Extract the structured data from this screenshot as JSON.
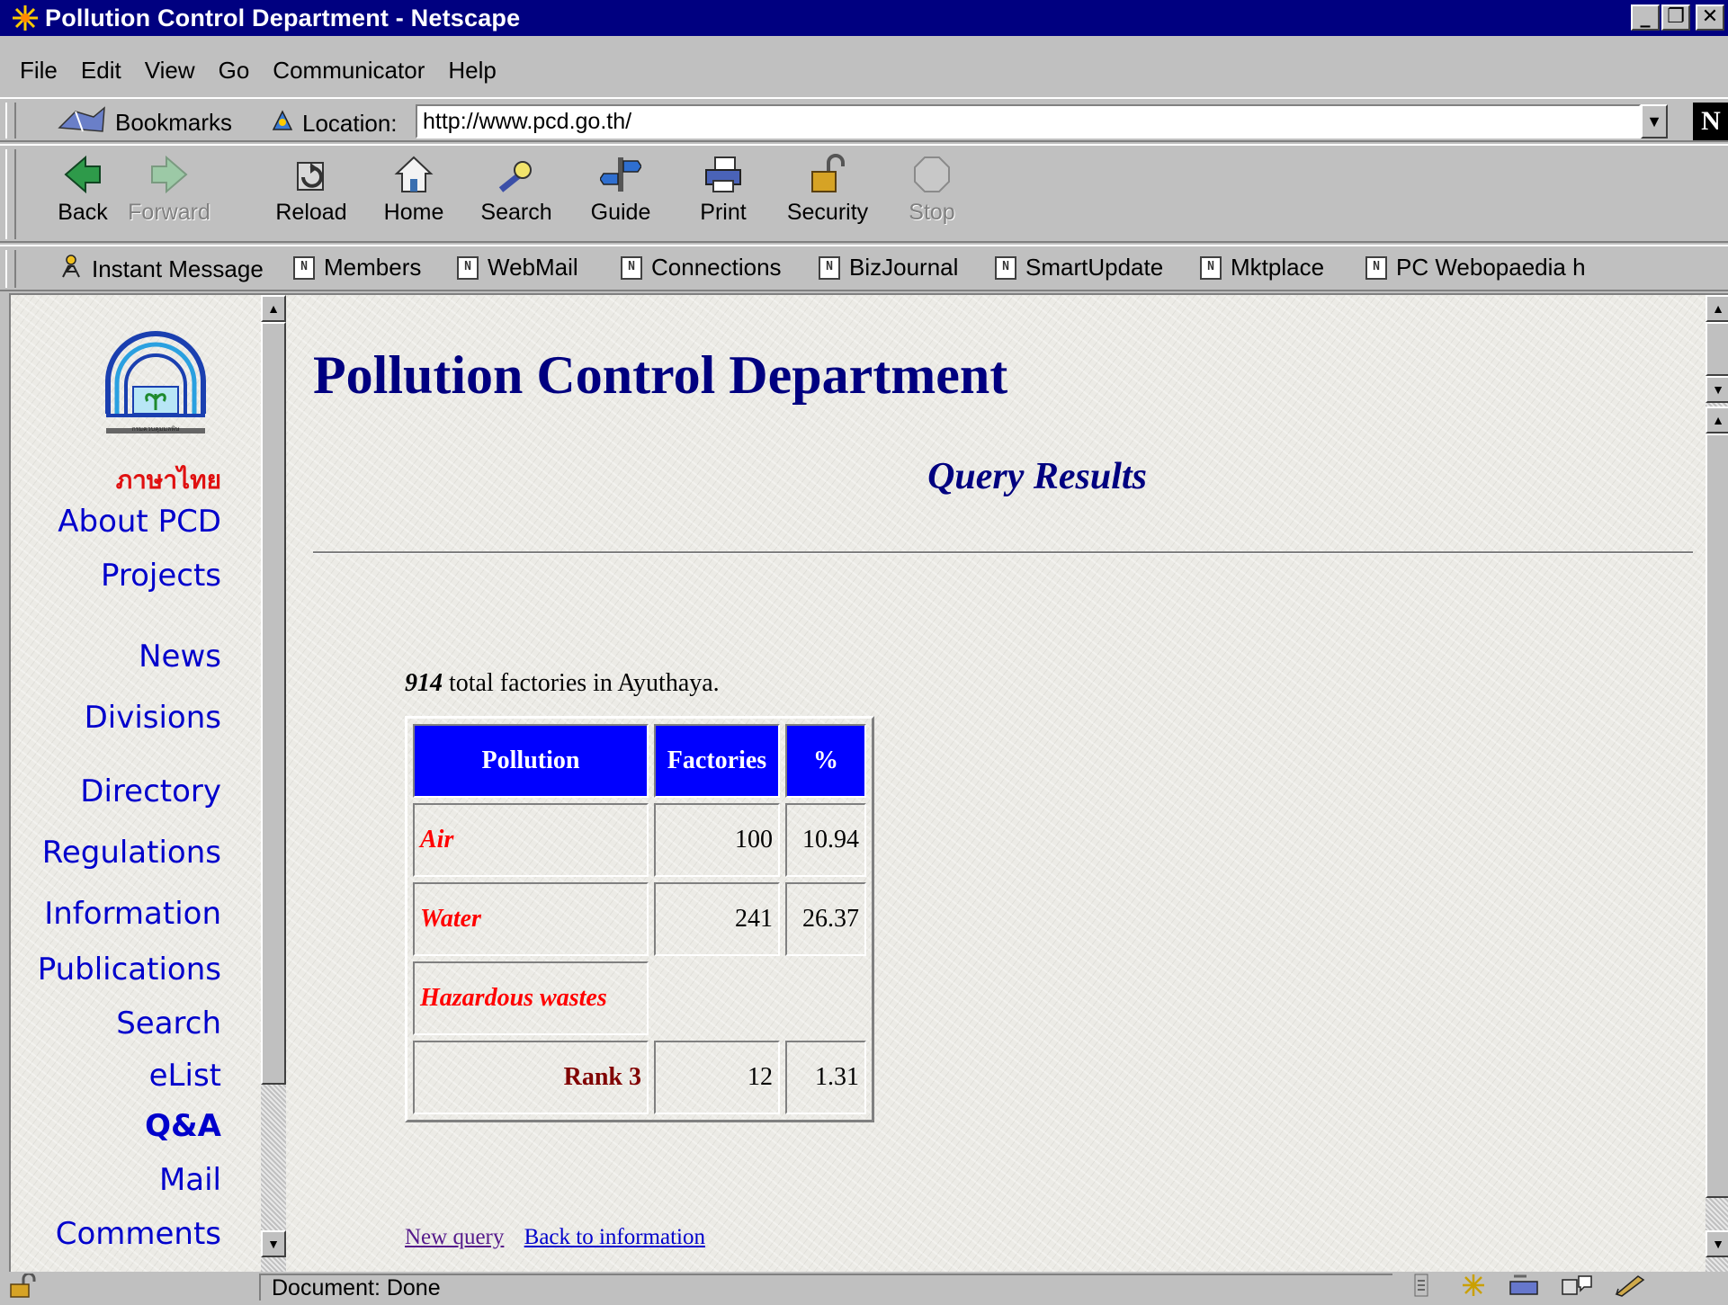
{
  "window": {
    "title": "Pollution Control Department - Netscape"
  },
  "menu": [
    "File",
    "Edit",
    "View",
    "Go",
    "Communicator",
    "Help"
  ],
  "location_bar": {
    "bookmarks_label": "Bookmarks",
    "location_label": "Location:",
    "url": "http://www.pcd.go.th/",
    "logo_letter": "N"
  },
  "nav_toolbar": [
    {
      "label": "Back",
      "icon": "back-arrow-icon",
      "enabled": true
    },
    {
      "label": "Forward",
      "icon": "forward-arrow-icon",
      "enabled": false
    },
    {
      "label": "Reload",
      "icon": "reload-icon",
      "enabled": true
    },
    {
      "label": "Home",
      "icon": "home-icon",
      "enabled": true
    },
    {
      "label": "Search",
      "icon": "search-icon",
      "enabled": true
    },
    {
      "label": "Guide",
      "icon": "guide-icon",
      "enabled": true
    },
    {
      "label": "Print",
      "icon": "print-icon",
      "enabled": true
    },
    {
      "label": "Security",
      "icon": "security-lock-icon",
      "enabled": true
    },
    {
      "label": "Stop",
      "icon": "stop-icon",
      "enabled": false
    }
  ],
  "personal_toolbar": [
    {
      "label": "Instant Message",
      "icon": "instant-message-icon"
    },
    {
      "label": "Members",
      "icon": "bookmark-icon"
    },
    {
      "label": "WebMail",
      "icon": "bookmark-icon"
    },
    {
      "label": "Connections",
      "icon": "bookmark-icon"
    },
    {
      "label": "BizJournal",
      "icon": "bookmark-icon"
    },
    {
      "label": "SmartUpdate",
      "icon": "bookmark-icon"
    },
    {
      "label": "Mktplace",
      "icon": "bookmark-icon"
    },
    {
      "label": "PC Webopaedia h",
      "icon": "bookmark-icon"
    }
  ],
  "sidebar": {
    "logo_caption": "กรมควบคุมมลพิษ",
    "thai_link": "ภาษาไทย",
    "links": [
      "About PCD",
      "Projects",
      "News",
      "Divisions",
      "Directory",
      "Regulations",
      "Information",
      "Publications",
      "Search",
      "eList",
      "Q&A",
      "Mail",
      "Comments"
    ]
  },
  "page": {
    "heading": "Pollution Control Department",
    "subheading": "Query Results",
    "total_count": "914",
    "total_text": " total factories in Ayuthaya.",
    "table": {
      "headers": [
        "Pollution",
        "Factories",
        "%"
      ],
      "rows": [
        {
          "name": "Air",
          "factories": "100",
          "percent": "10.94"
        },
        {
          "name": "Water",
          "factories": "241",
          "percent": "26.37"
        },
        {
          "name": "Hazardous wastes",
          "factories": "",
          "percent": ""
        },
        {
          "name": "Rank 3",
          "factories": "12",
          "percent": "1.31"
        }
      ]
    },
    "links": {
      "new_query": "New query",
      "back": "Back to information"
    }
  },
  "status": {
    "text": "Document: Done"
  },
  "colors": {
    "title_bg": "#000080",
    "heading": "#000080",
    "header_cell": "#0000ff",
    "item_red": "#ff0000",
    "rank": "#800000",
    "link": "#0000cc"
  }
}
